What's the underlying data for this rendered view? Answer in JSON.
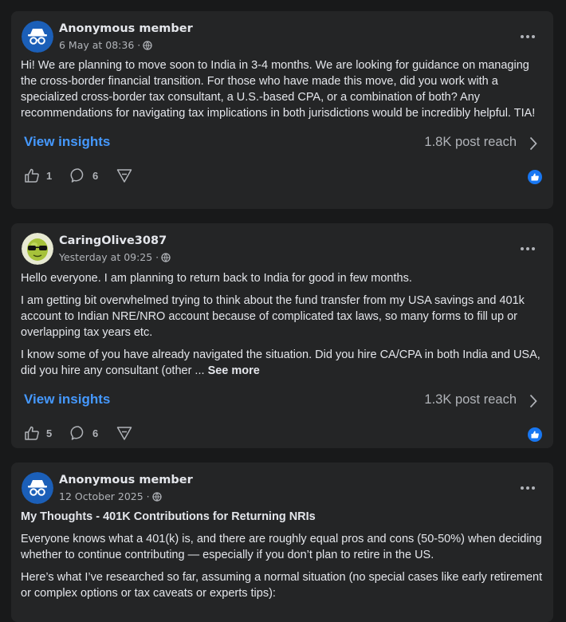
{
  "posts": [
    {
      "author": "Anonymous member",
      "timestamp": "6 May at 08:36 ·",
      "avatar_icon": "anonymous-member-icon",
      "title": "",
      "paragraphs": [
        "Hi! We are planning to move soon to India in 3-4 months. We are looking for guidance on managing the cross-border financial transition. For those who have made this move, did you work with a specialized cross-border tax consultant, a U.S.-based CPA, or a combination of both? Any recommendations for navigating tax implications in both jurisdictions would be incredibly helpful. TIA!"
      ],
      "insights_label": "View insights",
      "reach": "1.8K post reach",
      "likes": "1",
      "comments": "6"
    },
    {
      "author": "CaringOlive3087",
      "timestamp": "Yesterday at 09:25 ·",
      "avatar_icon": "olive-sunglasses-avatar",
      "title": "",
      "paragraphs": [
        "Hello everyone. I am planning to return back to India for good in few months.",
        "I am getting bit overwhelmed trying to think about the fund transfer from my USA savings and 401k account to Indian NRE/NRO account because of complicated tax laws, so many forms to fill up or overlapping tax years etc.",
        "I know some of you have already navigated the situation. Did you hire CA/CPA in both India and USA, did you hire any consultant (other ..."
      ],
      "see_more": "See more",
      "insights_label": "View insights",
      "reach": "1.3K post reach",
      "likes": "5",
      "comments": "6"
    },
    {
      "author": "Anonymous member",
      "timestamp": "12 October 2025 ·",
      "avatar_icon": "anonymous-member-icon",
      "title": "My Thoughts - 401K Contributions for Returning NRIs",
      "paragraphs": [
        "Everyone knows what a 401(k) is, and there are roughly equal pros and cons (50-50%) when deciding whether to continue contributing — especially if you don’t plan to retire in the US.",
        "Here’s what I’ve researched so far, assuming a normal situation (no special cases like early retirement or complex options or tax caveats or experts tips):"
      ]
    }
  ],
  "colors": {
    "background": "#18191a",
    "card": "#242526",
    "link": "#4599ff",
    "secondary_text": "#b0b3b8",
    "like_badge": "#1877f2"
  }
}
